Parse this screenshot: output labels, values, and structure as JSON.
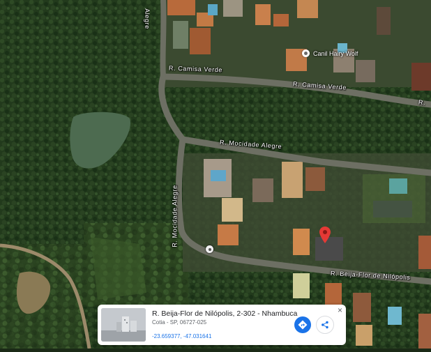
{
  "map": {
    "roads": {
      "camisa_verde_1": "R. Camisa Verde",
      "camisa_verde_2": "R. Camisa Verde",
      "camisa_verde_3": "R.",
      "mocidade_1": "R. Mocidade Alegre",
      "mocidade_2": "R. Mocidade Alegre",
      "mocidade_3": "Alegre",
      "beija_flor": "R. Beija-Flor de Nilópolis"
    },
    "poi": {
      "label": "Canil Hairy Wolf",
      "icon": "place-icon"
    },
    "pin": {
      "icon": "red-location-pin-icon",
      "color": "#e53935"
    }
  },
  "place_card": {
    "title": "R. Beija-Flor de Nilópolis, 2-302 - Nhambuca",
    "subtitle": "Cotia - SP, 06727-025",
    "coordinates": "-23.659377, -47.031641",
    "close_icon": "×",
    "directions_icon": "directions-icon",
    "share_icon": "share-icon",
    "accent_color": "#1a73e8"
  }
}
